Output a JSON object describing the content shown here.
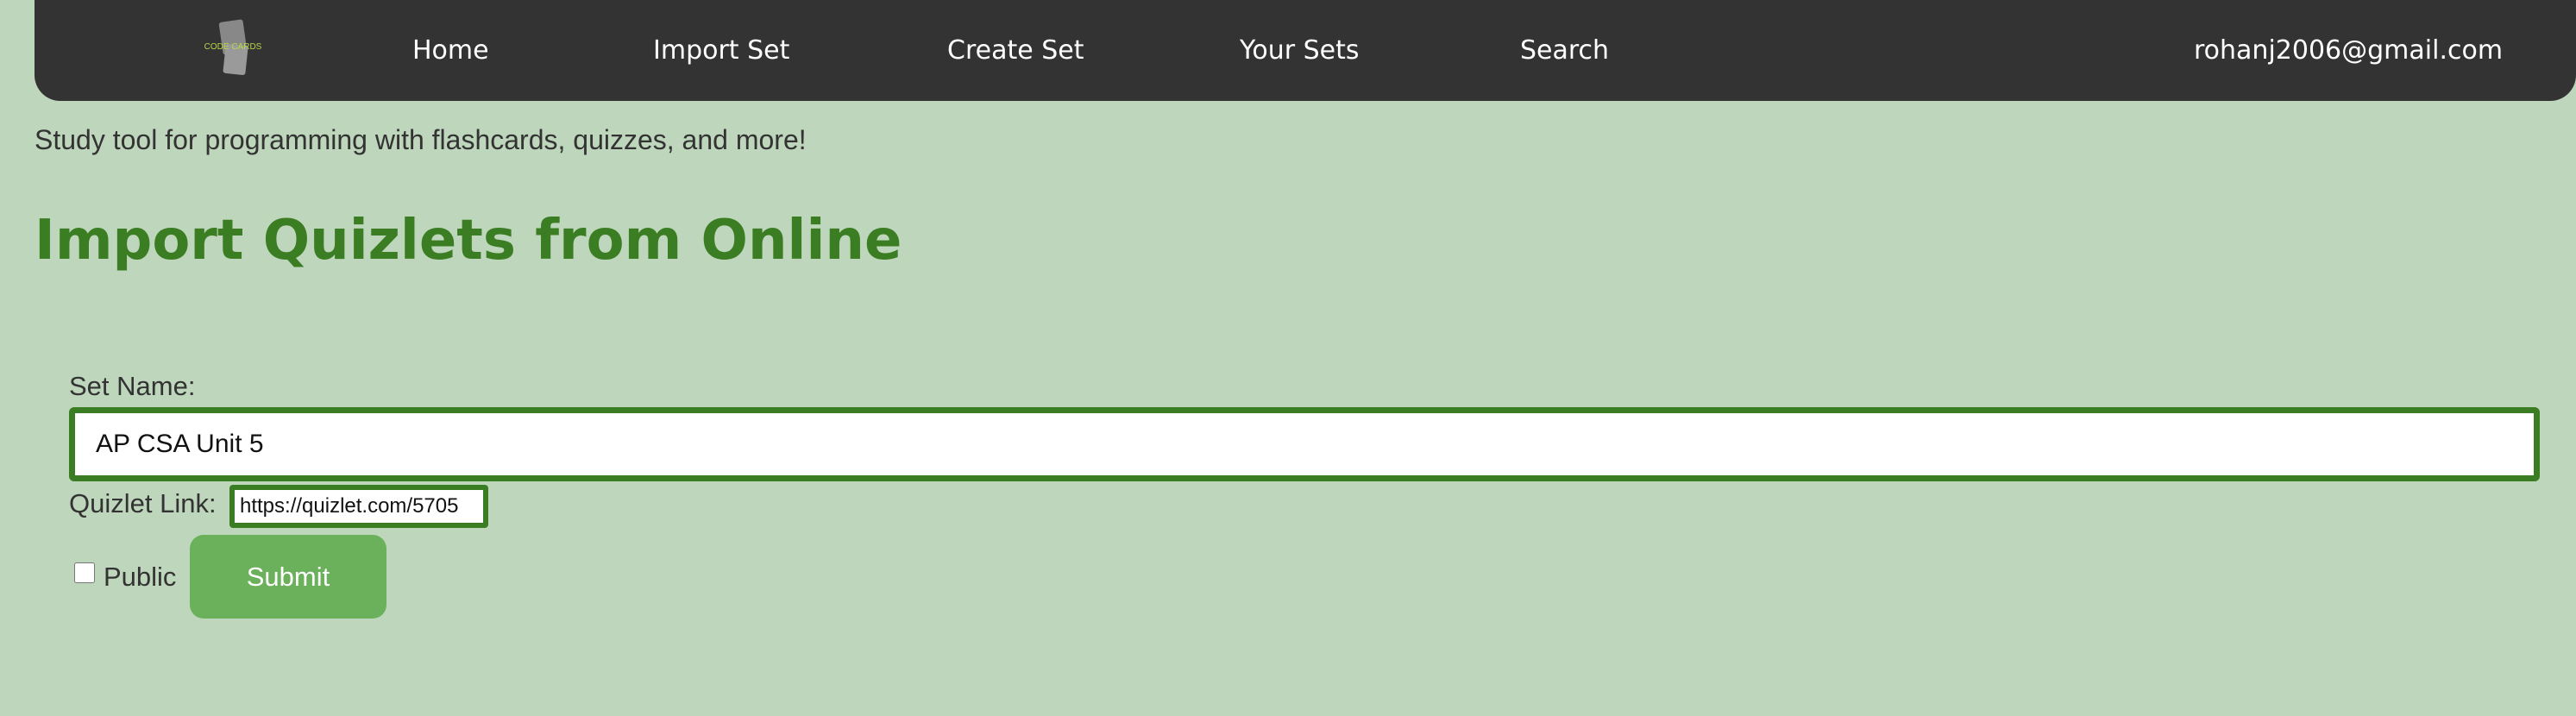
{
  "navbar": {
    "logo_text": "CODE CARDS",
    "links": [
      {
        "label": "Home"
      },
      {
        "label": "Import Set"
      },
      {
        "label": "Create Set"
      },
      {
        "label": "Your Sets"
      },
      {
        "label": "Search"
      }
    ],
    "user_email": "rohanj2006@gmail.com"
  },
  "tagline": "Study tool for programming with flashcards, quizzes, and more!",
  "page_title": "Import Quizlets from Online",
  "form": {
    "set_name_label": "Set Name:",
    "set_name_value": "AP CSA Unit 5",
    "quizlet_link_label": "Quizlet Link:",
    "quizlet_link_value": "https://quizlet.com/5705",
    "public_label": "Public",
    "public_checked": false,
    "submit_label": "Submit"
  },
  "colors": {
    "background": "#bed6bb",
    "navbar": "#333333",
    "accent_green": "#3a7d22",
    "button_green": "#6bb05b"
  }
}
